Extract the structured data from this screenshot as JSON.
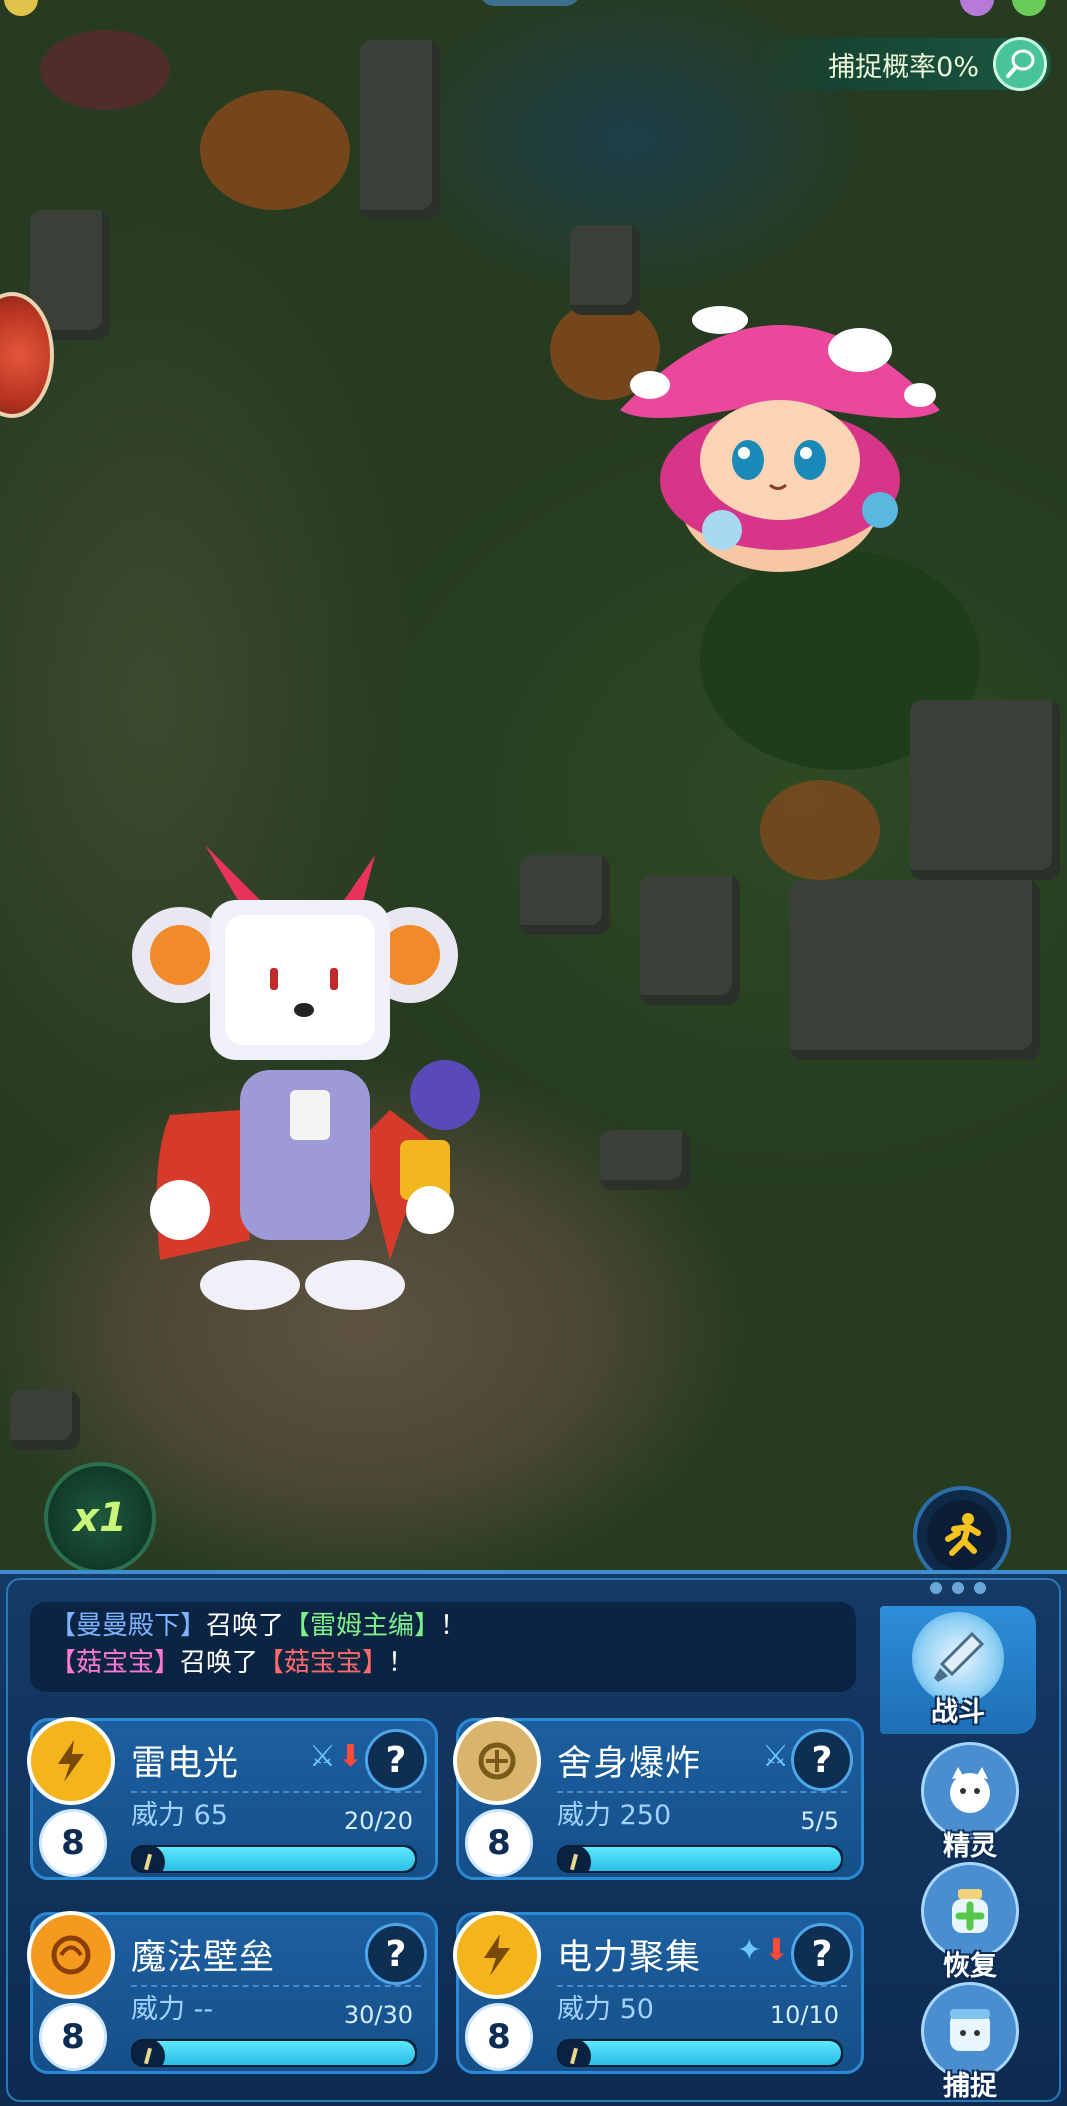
{
  "hud": {
    "capture_rate": "捕捉概率0%",
    "speed": "x1"
  },
  "battle_log": {
    "line1": {
      "summoner": "【曼曼殿下】",
      "verb": "召唤了",
      "pet": "【雷姆主编】",
      "end": "！"
    },
    "line2": {
      "summoner": "【菇宝宝】",
      "verb": "召唤了",
      "pet": "【菇宝宝】",
      "end": "！"
    }
  },
  "skills": [
    {
      "name": "雷电光",
      "power": "威力 65",
      "pp": "8",
      "count": "20/20",
      "fill": 1.0,
      "tags": [
        "sword",
        "down"
      ],
      "color": "#f4b41c"
    },
    {
      "name": "舍身爆炸",
      "power": "威力 250",
      "pp": "8",
      "count": "5/5",
      "fill": 1.0,
      "tags": [
        "sword"
      ],
      "color": "#d9b46a"
    },
    {
      "name": "魔法壁垒",
      "power": "威力 --",
      "pp": "8",
      "count": "30/30",
      "fill": 1.0,
      "tags": [],
      "color": "#f59a1e"
    },
    {
      "name": "电力聚集",
      "power": "威力 50",
      "pp": "8",
      "count": "10/10",
      "fill": 1.0,
      "tags": [
        "sparkle",
        "down"
      ],
      "color": "#f4b41c"
    }
  ],
  "side_menu": {
    "battle": "战斗",
    "spirit": "精灵",
    "recover": "恢复",
    "capture": "捕捉"
  },
  "colors": {
    "panel": "#143a66",
    "accent": "#2c8ad4",
    "bar": "#2bbde6"
  }
}
